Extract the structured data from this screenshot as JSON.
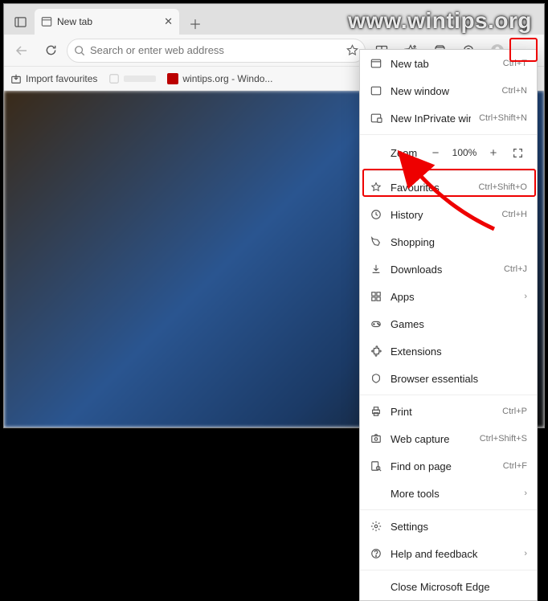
{
  "watermark": "www.wintips.org",
  "tab": {
    "title": "New tab"
  },
  "addressbar": {
    "placeholder": "Search or enter web address"
  },
  "bookmarks": {
    "import": "Import favourites",
    "wintips": "wintips.org - Windo..."
  },
  "menu": {
    "newtab": {
      "label": "New tab",
      "shortcut": "Ctrl+T"
    },
    "newwin": {
      "label": "New window",
      "shortcut": "Ctrl+N"
    },
    "inprivate": {
      "label": "New InPrivate window",
      "shortcut": "Ctrl+Shift+N"
    },
    "zoom": {
      "label": "Zoom",
      "value": "100%"
    },
    "fav": {
      "label": "Favourites",
      "shortcut": "Ctrl+Shift+O"
    },
    "history": {
      "label": "History",
      "shortcut": "Ctrl+H"
    },
    "shopping": {
      "label": "Shopping"
    },
    "downloads": {
      "label": "Downloads",
      "shortcut": "Ctrl+J"
    },
    "apps": {
      "label": "Apps"
    },
    "games": {
      "label": "Games"
    },
    "ext": {
      "label": "Extensions"
    },
    "essentials": {
      "label": "Browser essentials"
    },
    "print": {
      "label": "Print",
      "shortcut": "Ctrl+P"
    },
    "capture": {
      "label": "Web capture",
      "shortcut": "Ctrl+Shift+S"
    },
    "find": {
      "label": "Find on page",
      "shortcut": "Ctrl+F"
    },
    "moretools": {
      "label": "More tools"
    },
    "settings": {
      "label": "Settings"
    },
    "help": {
      "label": "Help and feedback"
    },
    "close": {
      "label": "Close Microsoft Edge"
    }
  }
}
